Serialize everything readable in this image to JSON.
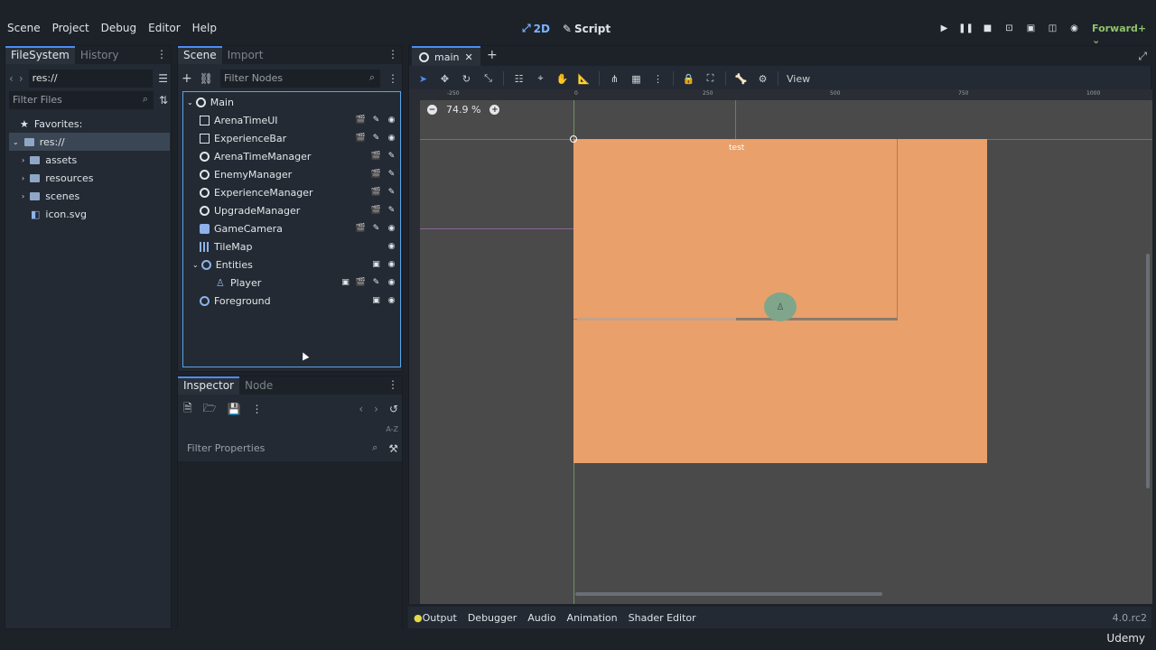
{
  "menu": [
    "Scene",
    "Project",
    "Debug",
    "Editor",
    "Help"
  ],
  "modes": {
    "m2d": "2D",
    "script": "Script"
  },
  "renderer": "Forward+",
  "filesystem": {
    "tabs": [
      "FileSystem",
      "History"
    ],
    "path": "res://",
    "filter_placeholder": "Filter Files",
    "favorites": "Favorites:",
    "root": "res://",
    "items": [
      "assets",
      "resources",
      "scenes",
      "icon.svg"
    ]
  },
  "scene": {
    "tabs": [
      "Scene",
      "Import"
    ],
    "filter_placeholder": "Filter Nodes",
    "nodes": [
      "Main",
      "ArenaTimeUI",
      "ExperienceBar",
      "ArenaTimeManager",
      "EnemyManager",
      "ExperienceManager",
      "UpgradeManager",
      "GameCamera",
      "TileMap",
      "Entities",
      "Player",
      "Foreground"
    ]
  },
  "inspector": {
    "tabs": [
      "Inspector",
      "Node"
    ],
    "filter_placeholder": "Filter Properties"
  },
  "viewport": {
    "tab": "main",
    "view_label": "View",
    "zoom": "74.9 %",
    "game_label": "test",
    "ruler_labels": [
      "-250",
      "0",
      "250",
      "500",
      "750",
      "1000"
    ]
  },
  "bottom": {
    "tabs": [
      "Output",
      "Debugger",
      "Audio",
      "Animation",
      "Shader Editor"
    ],
    "version": "4.0.rc2"
  },
  "watermark": "Udemy"
}
